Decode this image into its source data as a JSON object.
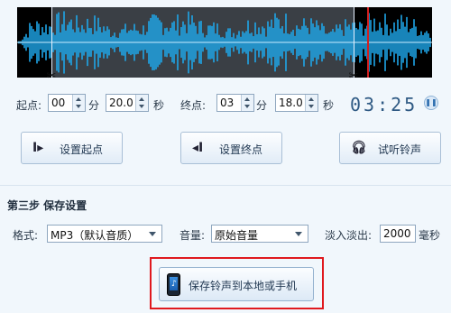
{
  "waveform": {
    "colors": {
      "background": "#000000",
      "selection": "#3a3f45",
      "wave": "#1fa6e8",
      "playhead": "#d31f1f"
    }
  },
  "time": {
    "start_label": "起点:",
    "start_min": "00",
    "min_unit": "分",
    "start_sec": "20.0",
    "sec_unit": "秒",
    "end_label": "终点:",
    "end_min": "03",
    "end_sec": "18.0",
    "clock": "03:25"
  },
  "buttons": {
    "set_start": "设置起点",
    "set_end": "设置终点",
    "preview": "试听铃声"
  },
  "settings": {
    "section_title": "第三步 保存设置",
    "format_label": "格式:",
    "format_value": "MP3（默认音质）",
    "volume_label": "音量:",
    "volume_value": "原始音量",
    "fade_label": "淡入淡出:",
    "fade_value": "2000",
    "fade_unit": "毫秒"
  },
  "save": {
    "label": "保存铃声到本地或手机"
  }
}
